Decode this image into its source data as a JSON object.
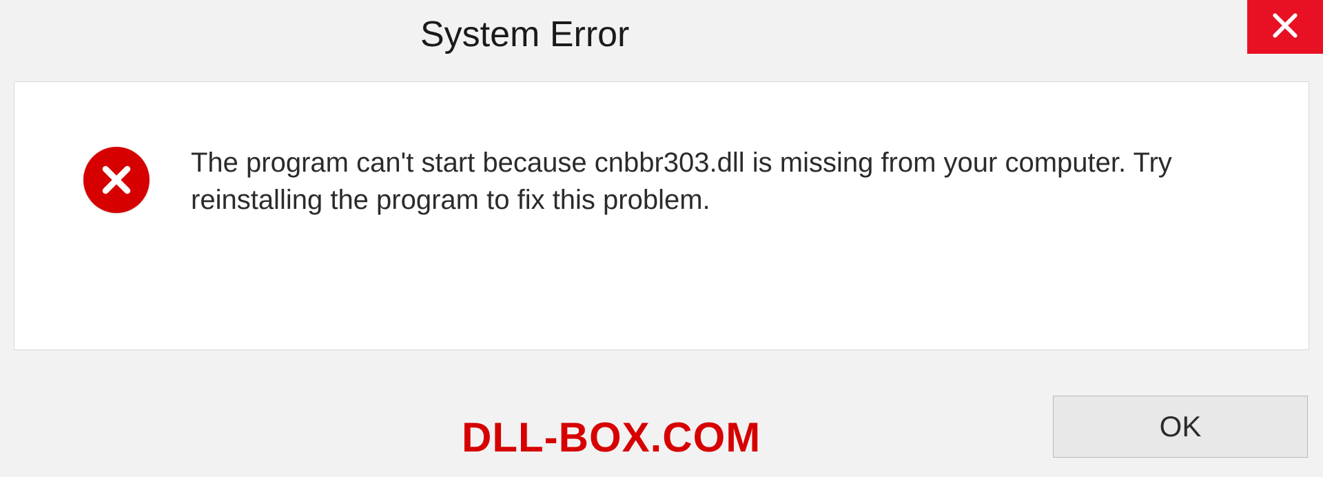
{
  "titlebar": {
    "title": "System Error"
  },
  "dialog": {
    "message": "The program can't start because cnbbr303.dll is missing from your computer. Try reinstalling the program to fix this problem."
  },
  "footer": {
    "watermark": "DLL-BOX.COM",
    "ok_label": "OK"
  },
  "icons": {
    "close": "close-icon",
    "error": "error-circle-x-icon"
  },
  "colors": {
    "close_bg": "#e81123",
    "error_red": "#d60000",
    "window_bg": "#f2f2f2",
    "content_bg": "#ffffff"
  }
}
